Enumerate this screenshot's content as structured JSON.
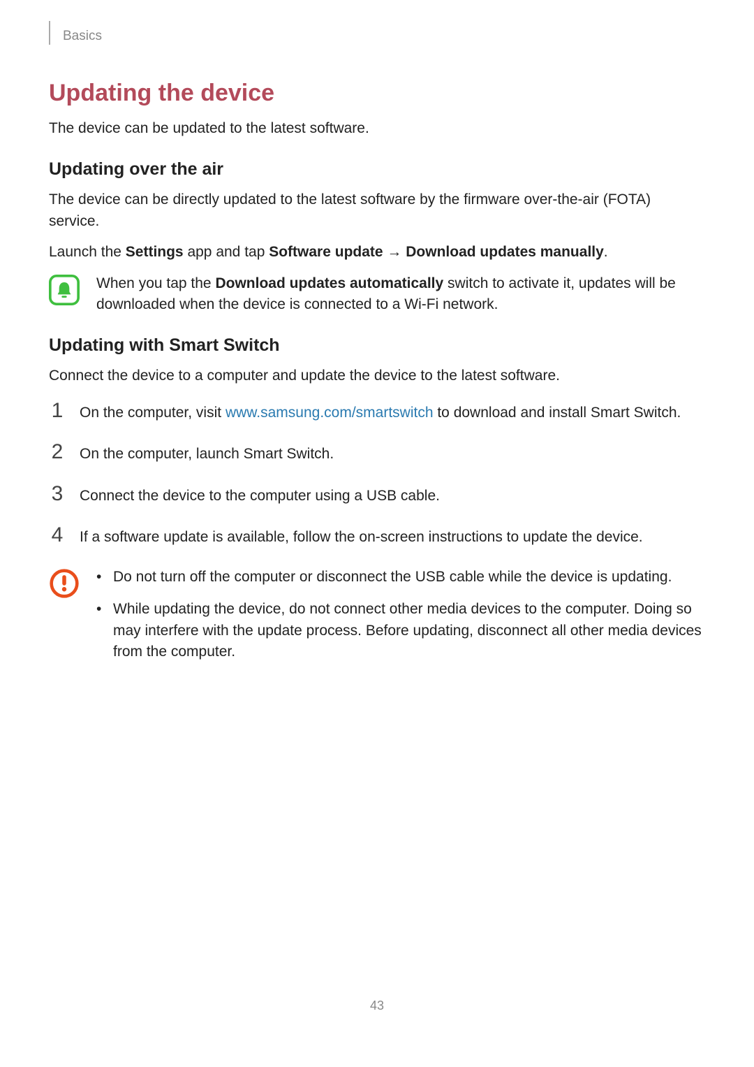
{
  "header": {
    "chapter": "Basics"
  },
  "title": "Updating the device",
  "intro": "The device can be updated to the latest software.",
  "ota": {
    "heading": "Updating over the air",
    "para1": "The device can be directly updated to the latest software by the firmware over-the-air (FOTA) service.",
    "para2_pre": "Launch the ",
    "para2_b1": "Settings",
    "para2_mid": " app and tap ",
    "para2_b2": "Software update",
    "para2_arrow": " → ",
    "para2_b3": "Download updates manually",
    "para2_post": ".",
    "note_pre": "When you tap the ",
    "note_b": "Download updates automatically",
    "note_post": " switch to activate it, updates will be downloaded when the device is connected to a Wi-Fi network."
  },
  "smart": {
    "heading": "Updating with Smart Switch",
    "intro": "Connect the device to a computer and update the device to the latest software.",
    "steps": {
      "n1": "1",
      "s1_pre": "On the computer, visit ",
      "s1_link": "www.samsung.com/smartswitch",
      "s1_post": " to download and install Smart Switch.",
      "n2": "2",
      "s2": "On the computer, launch Smart Switch.",
      "n3": "3",
      "s3": "Connect the device to the computer using a USB cable.",
      "n4": "4",
      "s4": "If a software update is available, follow the on-screen instructions to update the device."
    },
    "caution": {
      "b1": "Do not turn off the computer or disconnect the USB cable while the device is updating.",
      "b2": "While updating the device, do not connect other media devices to the computer. Doing so may interfere with the update process. Before updating, disconnect all other media devices from the computer."
    }
  },
  "page_number": "43"
}
